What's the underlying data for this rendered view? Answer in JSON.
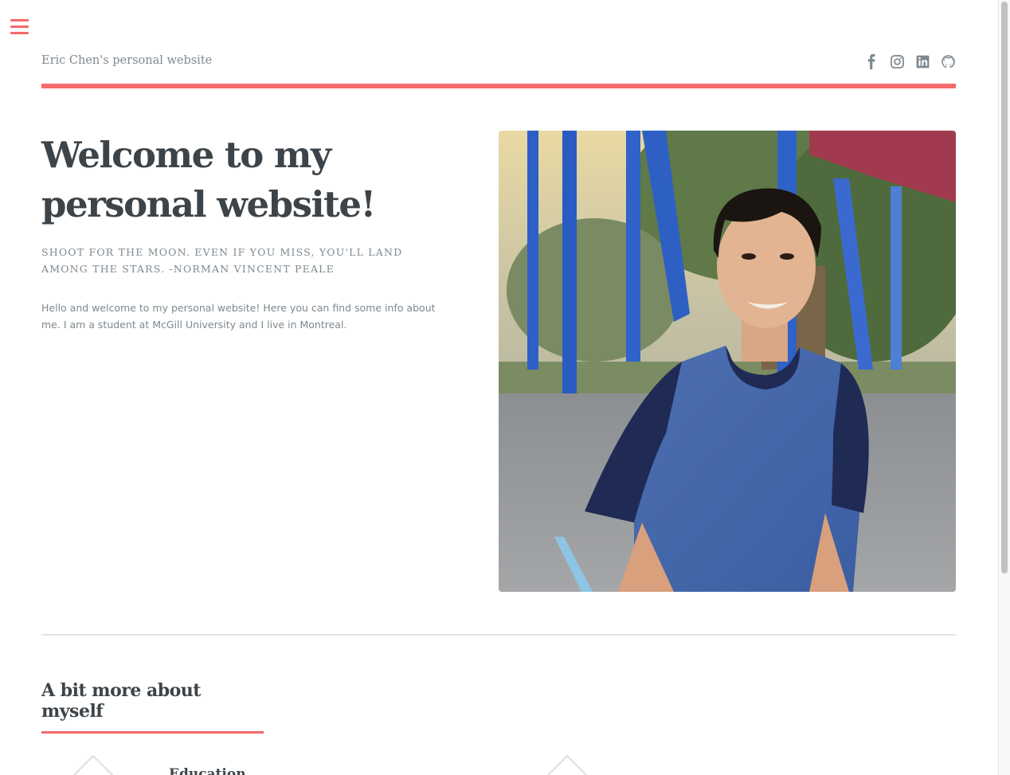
{
  "header": {
    "site_title": "Eric Chen's personal website",
    "social": [
      "facebook",
      "instagram",
      "linkedin",
      "github"
    ]
  },
  "banner": {
    "heading_line1": "Welcome to my",
    "heading_line2": "personal website!",
    "quote": "Shoot for the moon. Even if you miss, you'll land among the stars. -Norman Vincent Peale",
    "intro": "Hello and welcome to my personal website! Here you can find some info about me. I am a student at McGill University and I live in Montreal."
  },
  "about": {
    "title": "A bit more about myself",
    "features": [
      {
        "label": "Education"
      },
      {
        "label": ""
      }
    ]
  },
  "colors": {
    "accent": "#f56a6a",
    "text": "#3d4449",
    "muted": "#7f888f"
  },
  "icons": [
    "menu-icon",
    "facebook-icon",
    "instagram-icon",
    "linkedin-icon",
    "github-icon"
  ]
}
